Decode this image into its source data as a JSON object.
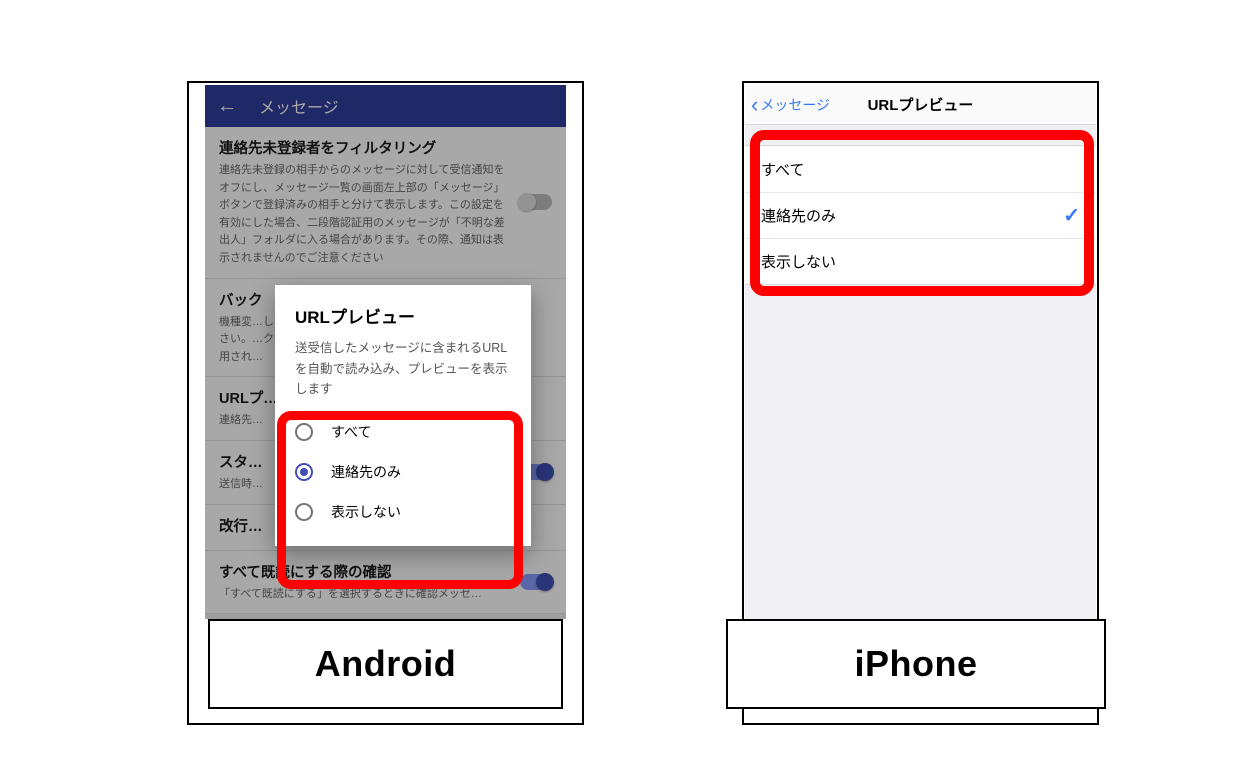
{
  "labels": {
    "android": "Android",
    "iphone": "iPhone"
  },
  "colors": {
    "accentBlue": "#3f51b5",
    "highlight": "#ff0000",
    "iosBlue": "#3478f6"
  },
  "android": {
    "appbar": {
      "back_icon": "←",
      "title": "メッセージ"
    },
    "cells": {
      "c0": {
        "title": "連絡先未登録者をフィルタリング",
        "desc": "連絡先未登録の相手からのメッセージに対して受信通知をオフにし、メッセージ一覧の画面左上部の「メッセージ」ボタンで登録済みの相手と分けて表示します。この設定を有効にした場合、二段階認証用のメッセージが「不明な差出人」フォルダに入る場合があります。その際、通知は表示されませんのでご注意ください"
      },
      "c1": {
        "title": "バック",
        "desc": "機種変…してくだ\nさい。…クが適\n用され…"
      },
      "c2": {
        "title": "URLプ…",
        "desc": "連絡先…"
      },
      "c3": {
        "title": "スタ…",
        "desc": "送信時…"
      },
      "c4": {
        "title": "改行…"
      },
      "c5": {
        "title": "すべて既読にする際の確認",
        "desc": "「すべて既読にする」を選択するときに確認メッセ…"
      }
    },
    "dialog": {
      "title": "URLプレビュー",
      "desc": "送受信したメッセージに含まれるURLを自動で読み込み、プレビューを表示します",
      "options": [
        {
          "label": "すべて",
          "selected": false
        },
        {
          "label": "連絡先のみ",
          "selected": true
        },
        {
          "label": "表示しない",
          "selected": false
        }
      ]
    }
  },
  "iphone": {
    "back_label": "メッセージ",
    "title": "URLプレビュー",
    "options": [
      {
        "label": "すべて",
        "selected": false
      },
      {
        "label": "連絡先のみ",
        "selected": true
      },
      {
        "label": "表示しない",
        "selected": false
      }
    ]
  }
}
